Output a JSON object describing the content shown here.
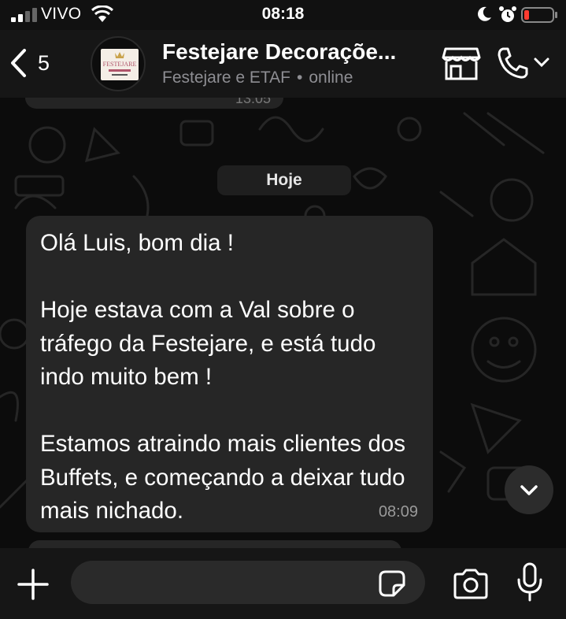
{
  "status_bar": {
    "carrier": "VIVO",
    "time": "08:18",
    "icons": [
      "signal-icon",
      "wifi-icon",
      "moon-icon",
      "alarm-icon",
      "battery-low-icon"
    ],
    "battery_color": "#ff3b30"
  },
  "header": {
    "back_count": "5",
    "title": "Festejare Decoraçõe...",
    "subtitle_members": "Festejare e ETAF",
    "subtitle_separator": "•",
    "subtitle_status": "online",
    "avatar_brand": "FESTEJARE",
    "icons": [
      "chevron-left-icon",
      "shop-icon",
      "phone-icon",
      "chevron-down-icon"
    ]
  },
  "chat": {
    "previous_message_time": "13:05",
    "day_label": "Hoje",
    "message": {
      "text": "Olá Luis, bom dia !\n\nHoje estava com a Val sobre o tráfego da Festejare, e está tudo indo muito bem !\n\nEstamos atraindo mais clientes dos Buffets, e começando a deixar tudo mais nichado.",
      "time": "08:09"
    }
  },
  "input_bar": {
    "placeholder": "",
    "icons": [
      "plus-icon",
      "sticker-icon",
      "camera-icon",
      "microphone-icon"
    ]
  },
  "colors": {
    "background": "#0c0c0c",
    "bubble": "#262626",
    "header": "#161616",
    "secondary_text": "#8e8e93"
  }
}
